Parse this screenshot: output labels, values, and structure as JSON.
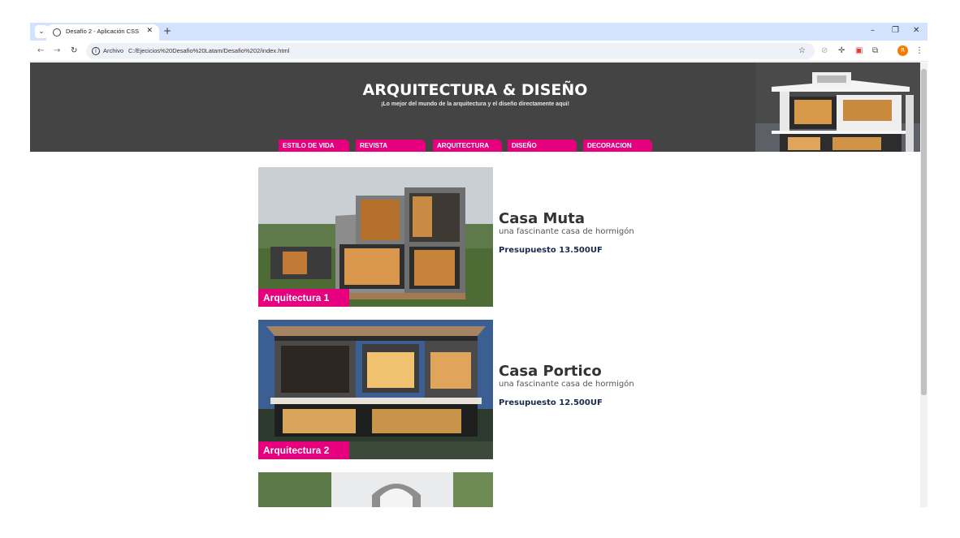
{
  "browser": {
    "tab_title": "Desafío 2 - Aplicación CSS",
    "scheme_label": "Archivo",
    "url": "C:/Ejecicios%20Desafio%20Latam/Desafio%202/index.html",
    "profile_initial": "R"
  },
  "header": {
    "title": "ARQUITECTURA & DISEÑO",
    "subtitle": "¡Lo mejor del mundo de la arquitectura y el diseño directamente aqui!"
  },
  "nav": {
    "items": [
      {
        "label": "ESTILO DE VIDA"
      },
      {
        "label": "REVISTA"
      },
      {
        "label": "ARQUITECTURA"
      },
      {
        "label": "DISEÑO"
      },
      {
        "label": "DECORACION"
      }
    ]
  },
  "cards": [
    {
      "label": "Arquitectura 1",
      "title": "Casa Muta",
      "subtitle": "una fascinante casa de hormigón",
      "price": "Presupuesto 13.500UF"
    },
    {
      "label": "Arquitectura 2",
      "title": "Casa Portico",
      "subtitle": "una fascinante casa de hormigón",
      "price": "Presupuesto 12.500UF"
    }
  ],
  "colors": {
    "accent": "#e6007e",
    "header_bg": "#444444"
  }
}
